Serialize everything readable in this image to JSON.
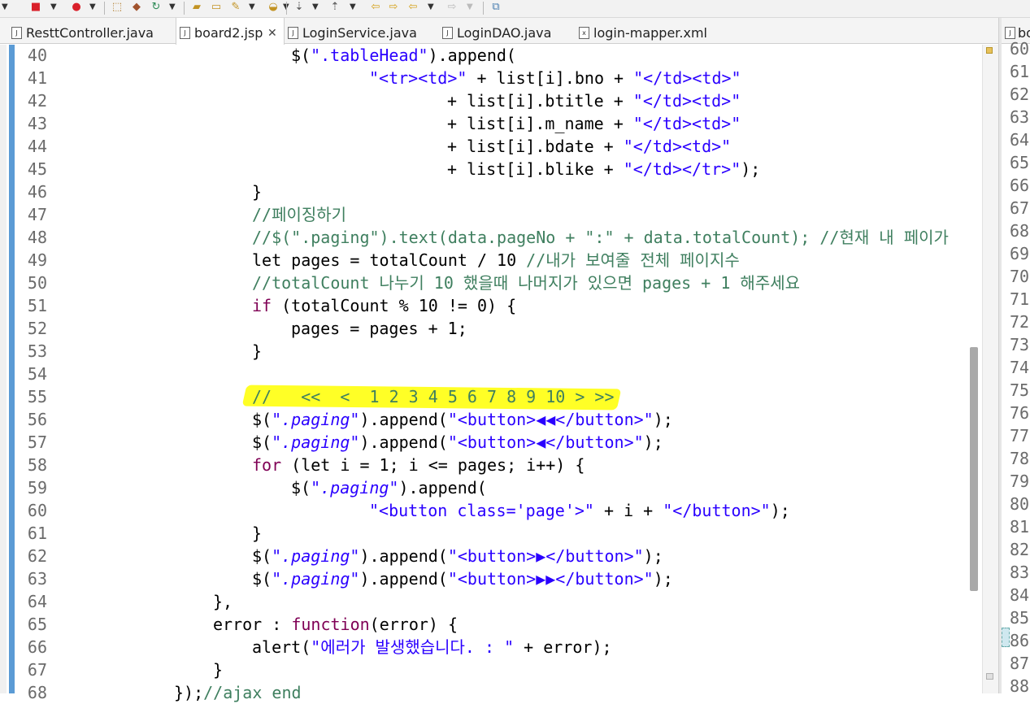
{
  "tabs": [
    {
      "label": "ResttController.java",
      "icon": "java-file-icon",
      "active": false
    },
    {
      "label": "board2.jsp",
      "icon": "jsp-file-icon",
      "active": true,
      "close": "✕"
    },
    {
      "label": "LoginService.java",
      "icon": "java-file-icon",
      "active": false
    },
    {
      "label": "LoginDAO.java",
      "icon": "java-file-icon",
      "active": false
    },
    {
      "label": "login-mapper.xml",
      "icon": "xml-file-icon",
      "active": false
    }
  ],
  "right_tab": {
    "label": "bo"
  },
  "toolbar_icons": [
    "debug-icon",
    "stop-icon",
    "run-icon",
    "open-type-icon",
    "new-class-icon",
    "refresh-icon",
    "open-icon",
    "folder-icon",
    "tools-icon",
    "task-icon",
    "next-annotation-icon",
    "prev-annotation-icon",
    "back-icon",
    "forward-icon",
    "back-arrow-icon",
    "forward-arrow-icon",
    "perspective-icon"
  ],
  "line_numbers": [
    "40",
    "41",
    "42",
    "43",
    "44",
    "45",
    "46",
    "47",
    "48",
    "49",
    "50",
    "51",
    "52",
    "53",
    "54",
    "55",
    "56",
    "57",
    "58",
    "59",
    "60",
    "61",
    "62",
    "63",
    "64",
    "65",
    "66",
    "67",
    "68"
  ],
  "code": {
    "l40": {
      "a": "$(",
      "b": "\".tableHead\"",
      "c": ").append("
    },
    "l41": {
      "a": "\"<tr><td>\"",
      "b": " + list[i].bno + ",
      "c": "\"</td><td>\""
    },
    "l42": {
      "a": "+ list[i].btitle + ",
      "b": "\"</td><td>\""
    },
    "l43": {
      "a": "+ list[i].m_name + ",
      "b": "\"</td><td>\""
    },
    "l44": {
      "a": "+ list[i].bdate + ",
      "b": "\"</td><td>\""
    },
    "l45": {
      "a": "+ list[i].blike + ",
      "b": "\"</td></tr>\"",
      "c": ");"
    },
    "l46": {
      "a": "}"
    },
    "l47": {
      "a": "//페이징하기"
    },
    "l48": {
      "a": "//$(\".paging\").text(data.pageNo + \":\" + data.totalCount); //현재 내 페이가"
    },
    "l49": {
      "a": "let pages = totalCount / 10 ",
      "b": "//내가 보여줄 전체 페이지수"
    },
    "l50": {
      "a": "//totalCount 나누기 10 했을때 나머지가 있으면 pages + 1 해주세요"
    },
    "l51": {
      "a": "if",
      "b": " (totalCount % 10 != 0) {"
    },
    "l52": {
      "a": "pages = pages + 1;"
    },
    "l53": {
      "a": "}"
    },
    "l54": {
      "a": ""
    },
    "l55": {
      "a": "//   <<  <  1 2 3 4 5 6 7 8 9 10 > >>"
    },
    "l56": {
      "a": "$(",
      "b": "\".paging\"",
      "c": ").append(",
      "d": "\"<button>◀◀</button>\"",
      "e": ");"
    },
    "l57": {
      "a": "$(",
      "b": "\".paging\"",
      "c": ").append(",
      "d": "\"<button>◀</button>\"",
      "e": ");"
    },
    "l58": {
      "a": "for",
      "b": " (let i = 1; i <= pages; i++) {"
    },
    "l59": {
      "a": "$(",
      "b": "\".paging\"",
      "c": ").append("
    },
    "l60": {
      "a": "\"<button class='page'>\"",
      "b": " + i + ",
      "c": "\"</button>\"",
      "d": ");"
    },
    "l61": {
      "a": "}"
    },
    "l62": {
      "a": "$(",
      "b": "\".paging\"",
      "c": ").append(",
      "d": "\"<button>▶</button>\"",
      "e": ");"
    },
    "l63": {
      "a": "$(",
      "b": "\".paging\"",
      "c": ").append(",
      "d": "\"<button>▶▶</button>\"",
      "e": ");"
    },
    "l64": {
      "a": "},"
    },
    "l65": {
      "a": "error : ",
      "b": "function",
      "c": "(error) {"
    },
    "l66": {
      "a": "alert(",
      "b": "\"에러가 발생했습니다. : \"",
      "c": " + error);"
    },
    "l67": {
      "a": "}"
    },
    "l68": {
      "a": "});",
      "b": "//ajax end"
    }
  },
  "right_line_numbers": [
    "60",
    "61",
    "62",
    "63",
    "64",
    "65",
    "66",
    "67",
    "68",
    "69",
    "70",
    "71",
    "72",
    "73",
    "74",
    "75",
    "76",
    "77",
    "78",
    "79",
    "80",
    "81",
    "82",
    "83",
    "84",
    "85",
    "86",
    "87",
    "88"
  ],
  "colors": {
    "keyword": "#7f0055",
    "string": "#2a00ff",
    "comment": "#3f7f5f",
    "highlight": "#ffff00",
    "change_bar": "#5b9bd5"
  }
}
